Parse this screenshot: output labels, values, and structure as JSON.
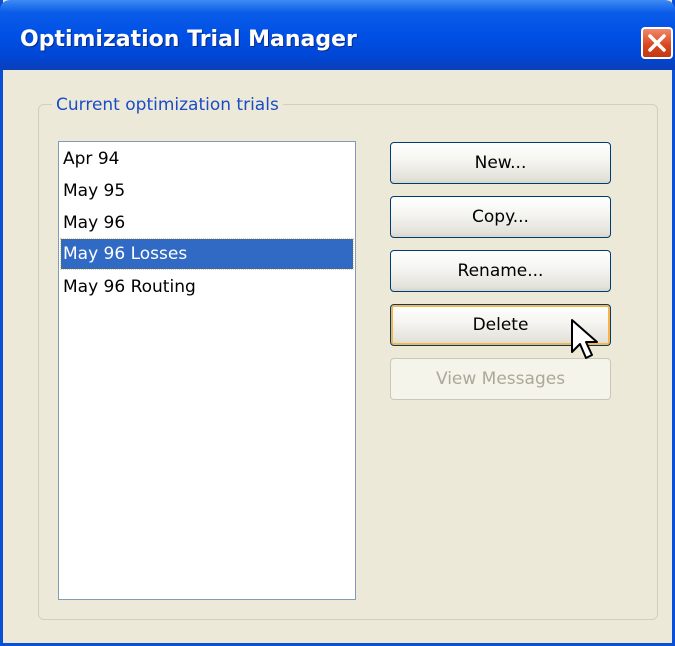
{
  "window": {
    "title": "Optimization Trial Manager"
  },
  "group": {
    "label": "Current optimization trials"
  },
  "trials": [
    {
      "label": "Apr 94",
      "selected": false
    },
    {
      "label": "May 95",
      "selected": false
    },
    {
      "label": "May 96",
      "selected": false
    },
    {
      "label": "May 96 Losses",
      "selected": true
    },
    {
      "label": "May 96 Routing",
      "selected": false
    }
  ],
  "buttons": {
    "new": "New...",
    "copy": "Copy...",
    "rename": "Rename...",
    "delete": "Delete",
    "view_messages": "View Messages"
  },
  "icons": {
    "close": "close-icon",
    "cursor": "mouse-pointer-icon"
  },
  "colors": {
    "titlebar": "#0050e6",
    "selection": "#316ac5",
    "group_label": "#1a4cc8",
    "close_button": "#d8451c"
  }
}
